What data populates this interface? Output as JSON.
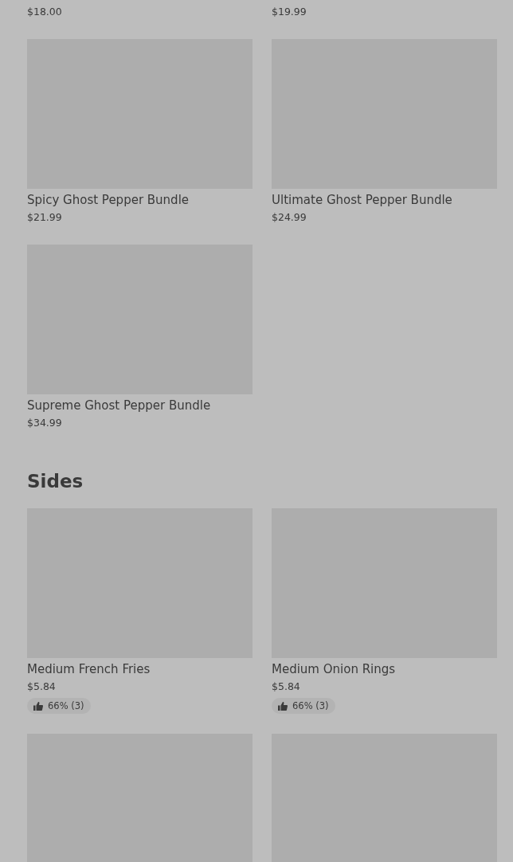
{
  "sections": [
    {
      "items": [
        {
          "price": "$18.00"
        },
        {
          "price": "$19.99"
        },
        {
          "image": true,
          "name": "Spicy Ghost Pepper Bundle",
          "price": "$21.99"
        },
        {
          "image": true,
          "name": "Ultimate Ghost Pepper Bundle",
          "price": "$24.99"
        },
        {
          "image": true,
          "name": "Supreme Ghost Pepper Bundle",
          "price": "$34.99"
        }
      ]
    },
    {
      "title": "Sides",
      "items": [
        {
          "image": true,
          "name": "Medium French Fries",
          "price": "$5.84",
          "rating": "66% (3)"
        },
        {
          "image": true,
          "name": "Medium Onion Rings",
          "price": "$5.84",
          "rating": "66% (3)"
        },
        {
          "image": true
        },
        {
          "image": true
        }
      ]
    }
  ]
}
